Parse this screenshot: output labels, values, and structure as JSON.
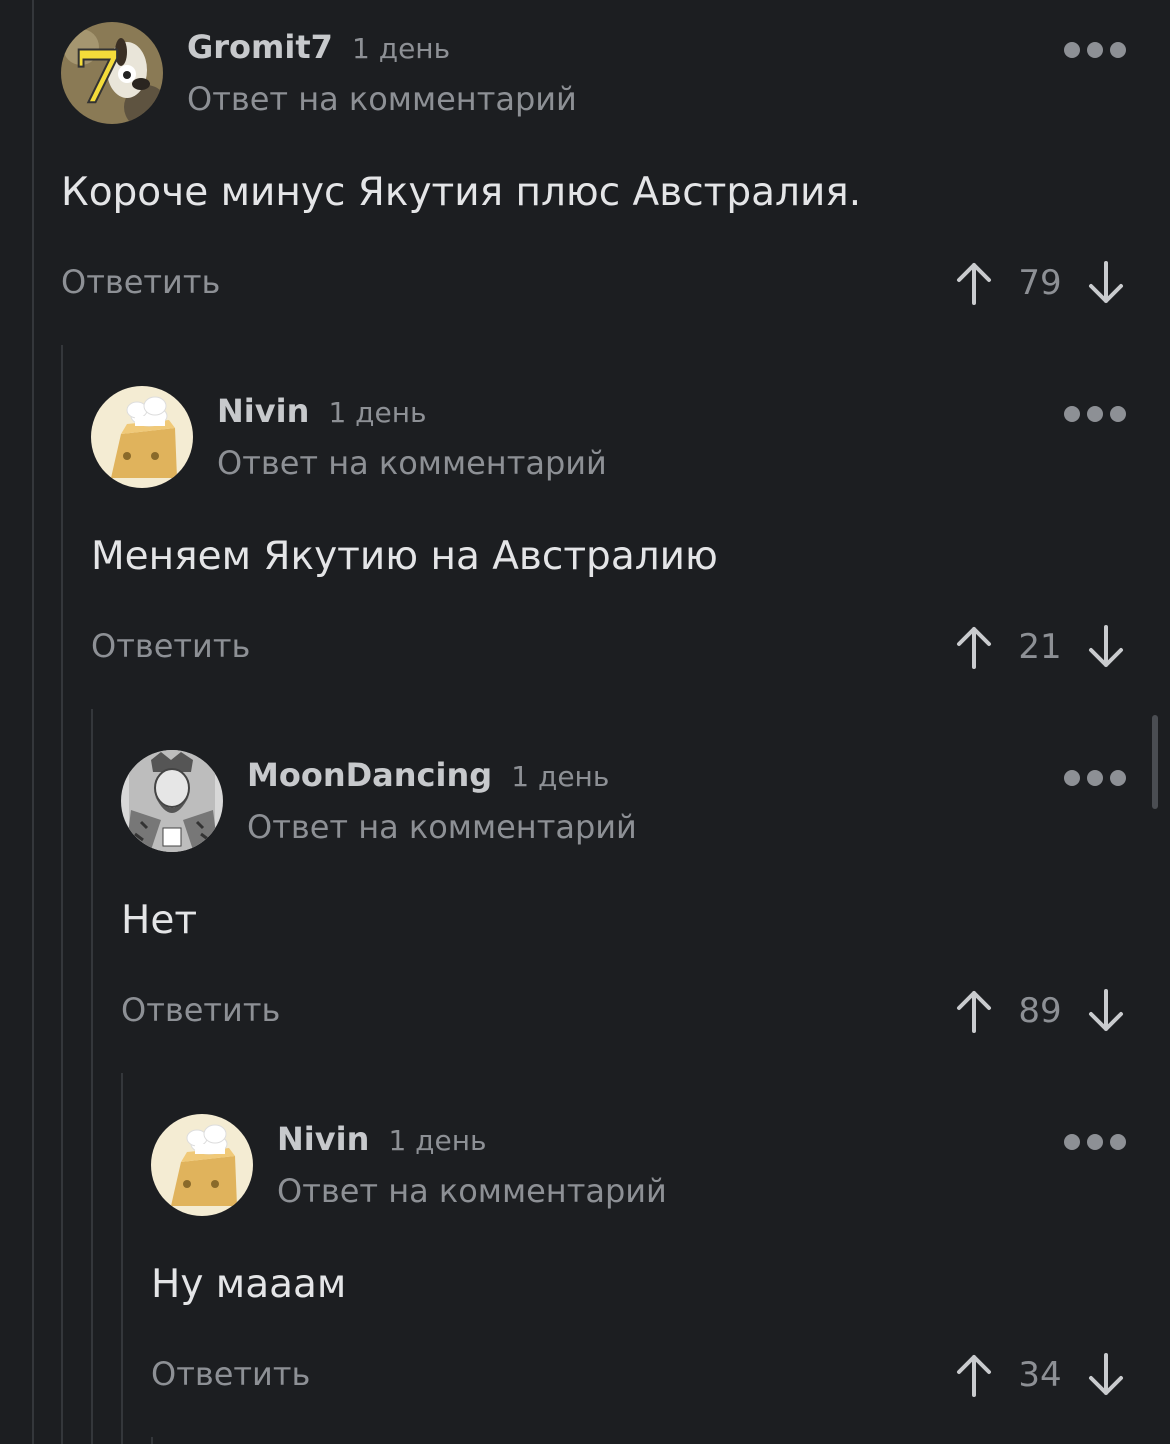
{
  "comments": [
    {
      "author": "Gromit7",
      "time": "1 день",
      "reply_to": "Ответ на комментарий",
      "text": "Короче минус Якутия плюс Австралия.",
      "reply_label": "Ответить",
      "score": "79",
      "avatar_badge": "7",
      "avatar_icon": "dog-avatar"
    },
    {
      "author": "Nivin",
      "time": "1 день",
      "reply_to": "Ответ на комментарий",
      "text": "Меняем Якутию на Австралию",
      "reply_label": "Ответить",
      "score": "21",
      "avatar_icon": "cheese-chef-avatar"
    },
    {
      "author": "MoonDancing",
      "time": "1 день",
      "reply_to": "Ответ на комментарий",
      "text": "Нет",
      "reply_label": "Ответить",
      "score": "89",
      "avatar_icon": "playing-card-king-avatar"
    },
    {
      "author": "Nivin",
      "time": "1 день",
      "reply_to": "Ответ на комментарий",
      "text": "Ну мааам",
      "reply_label": "Ответить",
      "score": "34",
      "avatar_icon": "cheese-chef-avatar"
    }
  ],
  "colors": {
    "background": "#1c1e21",
    "thread_line": "#34373b",
    "muted_text": "#8d9095",
    "body_text": "#e4e5e7"
  }
}
